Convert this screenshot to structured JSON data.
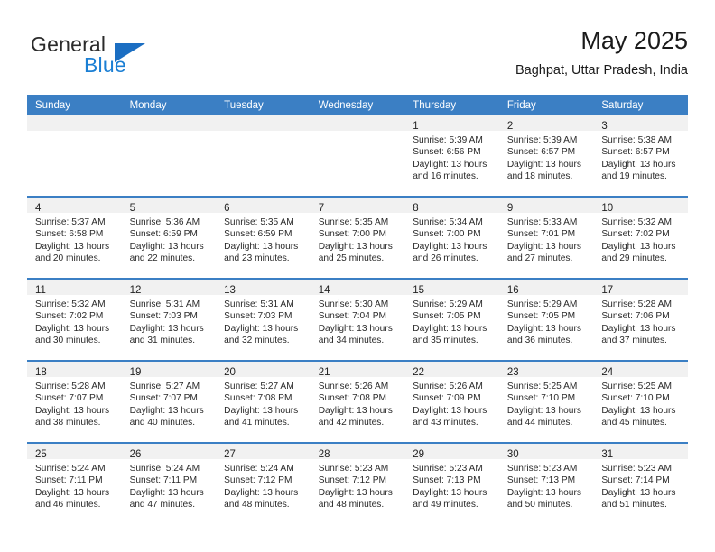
{
  "brand": {
    "name_part1": "General",
    "name_part2": "Blue",
    "colors": {
      "dark": "#2b2b2b",
      "blue": "#1b7fd4",
      "triangle": "#1b6ec2"
    }
  },
  "header": {
    "title": "May 2025",
    "subtitle": "Baghpat, Uttar Pradesh, India"
  },
  "theme": {
    "header_row_bg": "#3b7fc4",
    "daynum_band_bg": "#f1f1f1",
    "row_divider": "#3b7fc4"
  },
  "weekday_headers": [
    "Sunday",
    "Monday",
    "Tuesday",
    "Wednesday",
    "Thursday",
    "Friday",
    "Saturday"
  ],
  "weeks": [
    [
      {
        "day": "",
        "sunrise": "",
        "sunset": "",
        "daylight1": "",
        "daylight2": ""
      },
      {
        "day": "",
        "sunrise": "",
        "sunset": "",
        "daylight1": "",
        "daylight2": ""
      },
      {
        "day": "",
        "sunrise": "",
        "sunset": "",
        "daylight1": "",
        "daylight2": ""
      },
      {
        "day": "",
        "sunrise": "",
        "sunset": "",
        "daylight1": "",
        "daylight2": ""
      },
      {
        "day": "1",
        "sunrise": "Sunrise: 5:39 AM",
        "sunset": "Sunset: 6:56 PM",
        "daylight1": "Daylight: 13 hours",
        "daylight2": "and 16 minutes."
      },
      {
        "day": "2",
        "sunrise": "Sunrise: 5:39 AM",
        "sunset": "Sunset: 6:57 PM",
        "daylight1": "Daylight: 13 hours",
        "daylight2": "and 18 minutes."
      },
      {
        "day": "3",
        "sunrise": "Sunrise: 5:38 AM",
        "sunset": "Sunset: 6:57 PM",
        "daylight1": "Daylight: 13 hours",
        "daylight2": "and 19 minutes."
      }
    ],
    [
      {
        "day": "4",
        "sunrise": "Sunrise: 5:37 AM",
        "sunset": "Sunset: 6:58 PM",
        "daylight1": "Daylight: 13 hours",
        "daylight2": "and 20 minutes."
      },
      {
        "day": "5",
        "sunrise": "Sunrise: 5:36 AM",
        "sunset": "Sunset: 6:59 PM",
        "daylight1": "Daylight: 13 hours",
        "daylight2": "and 22 minutes."
      },
      {
        "day": "6",
        "sunrise": "Sunrise: 5:35 AM",
        "sunset": "Sunset: 6:59 PM",
        "daylight1": "Daylight: 13 hours",
        "daylight2": "and 23 minutes."
      },
      {
        "day": "7",
        "sunrise": "Sunrise: 5:35 AM",
        "sunset": "Sunset: 7:00 PM",
        "daylight1": "Daylight: 13 hours",
        "daylight2": "and 25 minutes."
      },
      {
        "day": "8",
        "sunrise": "Sunrise: 5:34 AM",
        "sunset": "Sunset: 7:00 PM",
        "daylight1": "Daylight: 13 hours",
        "daylight2": "and 26 minutes."
      },
      {
        "day": "9",
        "sunrise": "Sunrise: 5:33 AM",
        "sunset": "Sunset: 7:01 PM",
        "daylight1": "Daylight: 13 hours",
        "daylight2": "and 27 minutes."
      },
      {
        "day": "10",
        "sunrise": "Sunrise: 5:32 AM",
        "sunset": "Sunset: 7:02 PM",
        "daylight1": "Daylight: 13 hours",
        "daylight2": "and 29 minutes."
      }
    ],
    [
      {
        "day": "11",
        "sunrise": "Sunrise: 5:32 AM",
        "sunset": "Sunset: 7:02 PM",
        "daylight1": "Daylight: 13 hours",
        "daylight2": "and 30 minutes."
      },
      {
        "day": "12",
        "sunrise": "Sunrise: 5:31 AM",
        "sunset": "Sunset: 7:03 PM",
        "daylight1": "Daylight: 13 hours",
        "daylight2": "and 31 minutes."
      },
      {
        "day": "13",
        "sunrise": "Sunrise: 5:31 AM",
        "sunset": "Sunset: 7:03 PM",
        "daylight1": "Daylight: 13 hours",
        "daylight2": "and 32 minutes."
      },
      {
        "day": "14",
        "sunrise": "Sunrise: 5:30 AM",
        "sunset": "Sunset: 7:04 PM",
        "daylight1": "Daylight: 13 hours",
        "daylight2": "and 34 minutes."
      },
      {
        "day": "15",
        "sunrise": "Sunrise: 5:29 AM",
        "sunset": "Sunset: 7:05 PM",
        "daylight1": "Daylight: 13 hours",
        "daylight2": "and 35 minutes."
      },
      {
        "day": "16",
        "sunrise": "Sunrise: 5:29 AM",
        "sunset": "Sunset: 7:05 PM",
        "daylight1": "Daylight: 13 hours",
        "daylight2": "and 36 minutes."
      },
      {
        "day": "17",
        "sunrise": "Sunrise: 5:28 AM",
        "sunset": "Sunset: 7:06 PM",
        "daylight1": "Daylight: 13 hours",
        "daylight2": "and 37 minutes."
      }
    ],
    [
      {
        "day": "18",
        "sunrise": "Sunrise: 5:28 AM",
        "sunset": "Sunset: 7:07 PM",
        "daylight1": "Daylight: 13 hours",
        "daylight2": "and 38 minutes."
      },
      {
        "day": "19",
        "sunrise": "Sunrise: 5:27 AM",
        "sunset": "Sunset: 7:07 PM",
        "daylight1": "Daylight: 13 hours",
        "daylight2": "and 40 minutes."
      },
      {
        "day": "20",
        "sunrise": "Sunrise: 5:27 AM",
        "sunset": "Sunset: 7:08 PM",
        "daylight1": "Daylight: 13 hours",
        "daylight2": "and 41 minutes."
      },
      {
        "day": "21",
        "sunrise": "Sunrise: 5:26 AM",
        "sunset": "Sunset: 7:08 PM",
        "daylight1": "Daylight: 13 hours",
        "daylight2": "and 42 minutes."
      },
      {
        "day": "22",
        "sunrise": "Sunrise: 5:26 AM",
        "sunset": "Sunset: 7:09 PM",
        "daylight1": "Daylight: 13 hours",
        "daylight2": "and 43 minutes."
      },
      {
        "day": "23",
        "sunrise": "Sunrise: 5:25 AM",
        "sunset": "Sunset: 7:10 PM",
        "daylight1": "Daylight: 13 hours",
        "daylight2": "and 44 minutes."
      },
      {
        "day": "24",
        "sunrise": "Sunrise: 5:25 AM",
        "sunset": "Sunset: 7:10 PM",
        "daylight1": "Daylight: 13 hours",
        "daylight2": "and 45 minutes."
      }
    ],
    [
      {
        "day": "25",
        "sunrise": "Sunrise: 5:24 AM",
        "sunset": "Sunset: 7:11 PM",
        "daylight1": "Daylight: 13 hours",
        "daylight2": "and 46 minutes."
      },
      {
        "day": "26",
        "sunrise": "Sunrise: 5:24 AM",
        "sunset": "Sunset: 7:11 PM",
        "daylight1": "Daylight: 13 hours",
        "daylight2": "and 47 minutes."
      },
      {
        "day": "27",
        "sunrise": "Sunrise: 5:24 AM",
        "sunset": "Sunset: 7:12 PM",
        "daylight1": "Daylight: 13 hours",
        "daylight2": "and 48 minutes."
      },
      {
        "day": "28",
        "sunrise": "Sunrise: 5:23 AM",
        "sunset": "Sunset: 7:12 PM",
        "daylight1": "Daylight: 13 hours",
        "daylight2": "and 48 minutes."
      },
      {
        "day": "29",
        "sunrise": "Sunrise: 5:23 AM",
        "sunset": "Sunset: 7:13 PM",
        "daylight1": "Daylight: 13 hours",
        "daylight2": "and 49 minutes."
      },
      {
        "day": "30",
        "sunrise": "Sunrise: 5:23 AM",
        "sunset": "Sunset: 7:13 PM",
        "daylight1": "Daylight: 13 hours",
        "daylight2": "and 50 minutes."
      },
      {
        "day": "31",
        "sunrise": "Sunrise: 5:23 AM",
        "sunset": "Sunset: 7:14 PM",
        "daylight1": "Daylight: 13 hours",
        "daylight2": "and 51 minutes."
      }
    ]
  ]
}
